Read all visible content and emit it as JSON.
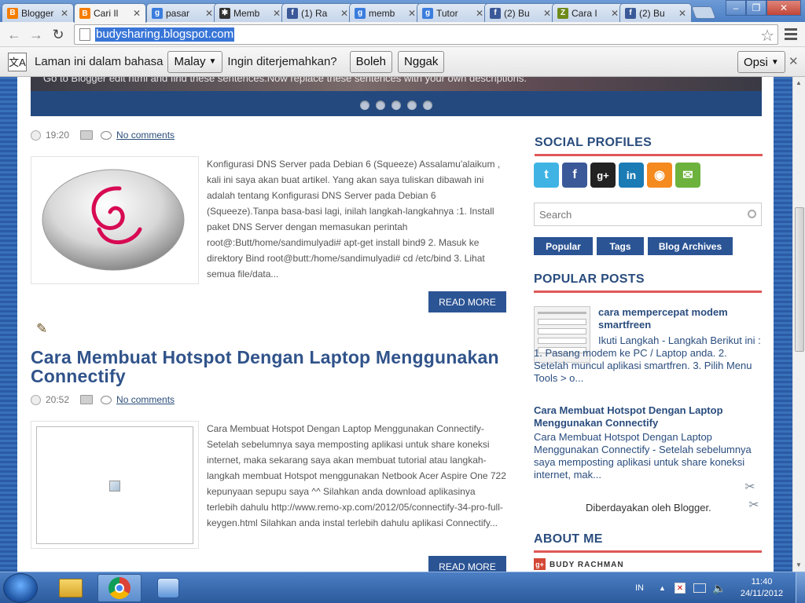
{
  "browser": {
    "tabs": [
      {
        "label": "Blogger",
        "icon": "blogger-icon",
        "color": "#f57d00",
        "glyph": "B",
        "active": false
      },
      {
        "label": "Cari Il",
        "icon": "blogger-icon",
        "color": "#f57d00",
        "glyph": "B",
        "active": true
      },
      {
        "label": "pasar",
        "icon": "google-icon",
        "color": "#3b7ddd",
        "glyph": "g",
        "active": false
      },
      {
        "label": "Memb",
        "icon": "spider-icon",
        "color": "#333333",
        "glyph": "✱",
        "active": false
      },
      {
        "label": "(1) Ra",
        "icon": "facebook-icon",
        "color": "#3b5998",
        "glyph": "f",
        "active": false
      },
      {
        "label": "memb",
        "icon": "google-icon",
        "color": "#3b7ddd",
        "glyph": "g",
        "active": false
      },
      {
        "label": "Tutor",
        "icon": "google-icon",
        "color": "#3b7ddd",
        "glyph": "g",
        "active": false
      },
      {
        "label": "(2) Bu",
        "icon": "facebook-icon",
        "color": "#3b5998",
        "glyph": "f",
        "active": false
      },
      {
        "label": "Cara I",
        "icon": "zone-icon",
        "color": "#6e8a1a",
        "glyph": "Z",
        "active": false
      },
      {
        "label": "(2) Bu",
        "icon": "facebook-icon",
        "color": "#3b5998",
        "glyph": "f",
        "active": false
      }
    ],
    "url": "budysharing.blogspot.com"
  },
  "translate_bar": {
    "prompt": "Laman ini dalam bahasa",
    "language": "Malay",
    "question": "Ingin diterjemahkan?",
    "yes": "Boleh",
    "no": "Nggak",
    "options": "Opsi"
  },
  "slider": {
    "caption": "Go to Blogger edit html and find these sentences.Now replace these sentences with your own descriptions."
  },
  "posts": [
    {
      "time": "19:20",
      "comments": "No comments",
      "excerpt": "Konfigurasi DNS Server pada Debian 6 (Squeeze) Assalamu'alaikum , kali ini saya akan buat artikel. Yang akan saya tuliskan dibawah ini adalah tentang Konfigurasi DNS Server pada Debian 6 (Squeeze).Tanpa basa-basi lagi, inilah langkah-langkahnya :1. Install paket DNS Server dengan memasukan perintah root@:Butt/home/sandimulyadi# apt-get install bind9 2. Masuk ke direktory Bind root@butt:/home/sandimulyadi# cd /etc/bind 3. Lihat semua file/data...",
      "read_more": "READ MORE"
    },
    {
      "title": "Cara Membuat Hotspot Dengan Laptop Menggunakan Connectify",
      "time": "20:52",
      "comments": "No comments",
      "excerpt": "Cara Membuat Hotspot Dengan Laptop Menggunakan Connectify- Setelah sebelumnya saya memposting aplikasi untuk share koneksi internet, maka sekarang saya akan membuat tutorial atau langkah-langkah membuat Hotspot menggunakan Netbook Acer Aspire One 722 kepunyaan sepupu saya ^^ Silahkan anda download aplikasinya terlebih dahulu http://www.remo-xp.com/2012/05/connectify-34-pro-full-keygen.html Silahkan anda instal terlebih dahulu aplikasi Connectify...",
      "read_more": "READ MORE"
    }
  ],
  "sidebar": {
    "social_heading": "SOCIAL PROFILES",
    "social": [
      {
        "name": "twitter-icon",
        "glyph": "t",
        "color": "#3fb4e4"
      },
      {
        "name": "facebook-icon",
        "glyph": "f",
        "color": "#3b5998"
      },
      {
        "name": "google-plus-icon",
        "glyph": "g+",
        "color": "#222222"
      },
      {
        "name": "linkedin-icon",
        "glyph": "in",
        "color": "#1a7bb5"
      },
      {
        "name": "rss-icon",
        "glyph": "◉",
        "color": "#f58a1f"
      },
      {
        "name": "email-icon",
        "glyph": "✉",
        "color": "#6cb23d"
      }
    ],
    "search_placeholder": "Search",
    "tabs": [
      "Popular",
      "Tags",
      "Blog Archives"
    ],
    "popular_heading": "POPULAR POSTS",
    "popular": [
      {
        "title": "cara mempercepat modem smartfreen",
        "text": "Ikuti Langkah - Langkah Berikut ini : 1. Pasang modem ke PC / Laptop anda. 2. Setelah muncul aplikasi smartfren. 3. Pilih Menu Tools > o..."
      },
      {
        "title": "Cara Membuat Hotspot Dengan Laptop Menggunakan Connectify",
        "text": "Cara Membuat Hotspot Dengan Laptop Menggunakan Connectify - Setelah sebelumnya saya memposting aplikasi untuk share koneksi internet, mak..."
      }
    ],
    "powered_by": "Diberdayakan oleh Blogger.",
    "about_heading": "ABOUT ME",
    "about_name": "BUDY RACHMAN"
  },
  "taskbar": {
    "lang": "IN",
    "time": "11:40",
    "date": "24/11/2012"
  }
}
